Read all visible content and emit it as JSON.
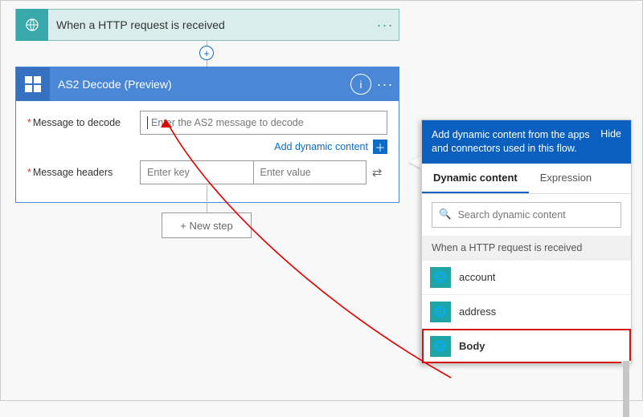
{
  "trigger": {
    "title": "When a HTTP request is received"
  },
  "as2": {
    "title": "AS2 Decode  (Preview)",
    "labels": {
      "message": "Message to decode",
      "headers": "Message headers"
    },
    "placeholders": {
      "message": "Enter the AS2 message to decode",
      "key": "Enter key",
      "value": "Enter value"
    },
    "adc_label": "Add dynamic content"
  },
  "new_step": "+ New step",
  "panel": {
    "header": "Add dynamic content from the apps and connectors used in this flow.",
    "hide": "Hide",
    "tabs": {
      "dynamic": "Dynamic content",
      "expression": "Expression"
    },
    "search_placeholder": "Search dynamic content",
    "section": "When a HTTP request is received",
    "items": [
      {
        "label": "account"
      },
      {
        "label": "address"
      },
      {
        "label": "Body"
      }
    ]
  }
}
